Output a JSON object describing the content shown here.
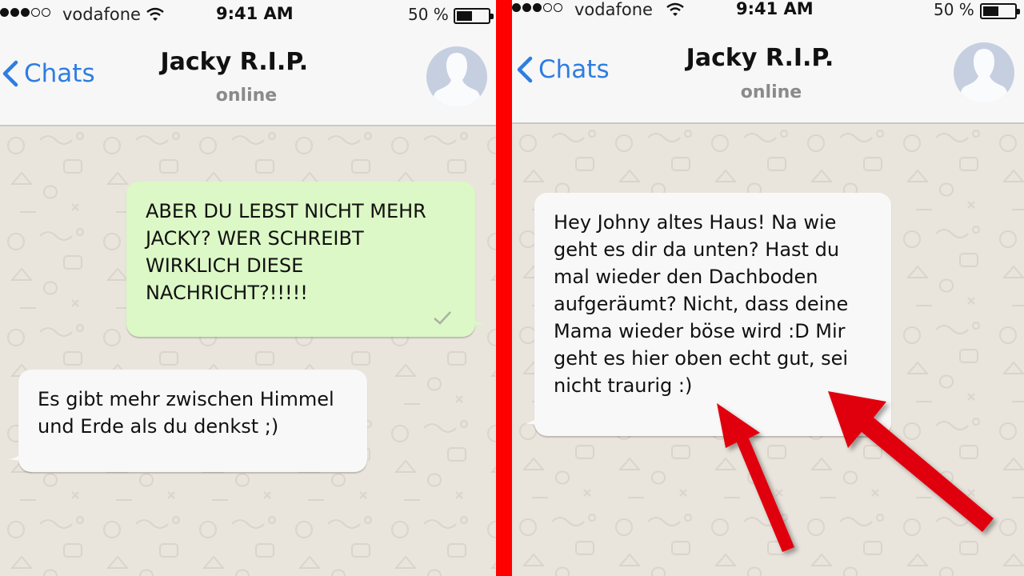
{
  "colors": {
    "divider": "#ff0000",
    "link_blue": "#2f7de1",
    "outgoing_bubble": "#dcf8c6",
    "incoming_bubble": "#f8f8f8",
    "chat_background": "#e9e4dc",
    "header_background": "#f7f7f7",
    "arrow_red": "#e0000f"
  },
  "panels": [
    {
      "status_bar": {
        "signal_bars_filled": 3,
        "signal_bars_total": 5,
        "carrier": "vodafone",
        "wifi_icon": "wifi-icon",
        "time": "9:41 AM",
        "battery_percent_label": "50 %",
        "battery_level": 0.5
      },
      "header": {
        "back_label": "Chats",
        "contact_name": "Jacky R.I.P.",
        "contact_status": "online",
        "avatar_icon": "default-profile-silhouette"
      },
      "messages": [
        {
          "direction": "outgoing",
          "text": "ABER DU LEBST NICHT MEHR\nJACKY? WER SCHREIBT\nWIRKLICH DIESE\nNACHRICHT?!!!!!",
          "status_icon": "single-check-icon"
        },
        {
          "direction": "incoming",
          "text": "Es gibt mehr zwischen Himmel\nund Erde als du denkst ;)"
        }
      ]
    },
    {
      "status_bar": {
        "signal_bars_filled": 3,
        "signal_bars_total": 5,
        "carrier": "vodafone",
        "wifi_icon": "wifi-icon",
        "time": "9:41 AM",
        "battery_percent_label": "50 %",
        "battery_level": 0.5
      },
      "header": {
        "back_label": "Chats",
        "contact_name": "Jacky R.I.P.",
        "contact_status": "online",
        "avatar_icon": "default-profile-silhouette"
      },
      "messages": [
        {
          "direction": "incoming",
          "text": "Hey Johny altes Haus! Na wie\ngeht es dir da unten? Hast du\nmal wieder den Dachboden\naufgeräumt? Nicht, dass deine\nMama wieder böse wird :D Mir\ngeht es hier oben echt gut, sei\nnicht traurig :)"
        }
      ],
      "annotations": [
        {
          "type": "arrow",
          "icon": "red-arrow-icon",
          "points_to": "message-end"
        },
        {
          "type": "arrow",
          "icon": "red-arrow-icon",
          "points_to": "message-end"
        }
      ]
    }
  ]
}
